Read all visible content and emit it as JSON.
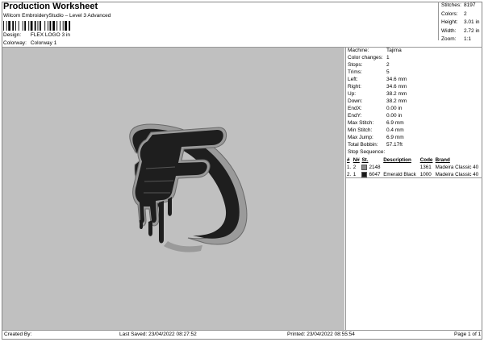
{
  "header": {
    "title": "Production Worksheet",
    "subtitle": "Wilcom EmbroideryStudio – Level 3 Advanced",
    "design_label": "Design:",
    "design_value": "FLEX LOGO 3 in",
    "colorway_label": "Colorway:",
    "colorway_value": "Colorway 1"
  },
  "top_stats": [
    {
      "label": "Stitches:",
      "value": "8197"
    },
    {
      "label": "Colors:",
      "value": "2"
    },
    {
      "label": "Height:",
      "value": "3.01 in"
    },
    {
      "label": "Width:",
      "value": "2.72 in"
    },
    {
      "label": "Zoom:",
      "value": "1:1"
    }
  ],
  "properties": [
    {
      "label": "Machine:",
      "value": "Tajima"
    },
    {
      "label": "Color changes:",
      "value": "1"
    },
    {
      "label": "Stops:",
      "value": "2"
    },
    {
      "label": "Trims:",
      "value": "5"
    },
    {
      "label": "Left:",
      "value": "34.6 mm"
    },
    {
      "label": "Right:",
      "value": "34.6 mm"
    },
    {
      "label": "Up:",
      "value": "38.2 mm"
    },
    {
      "label": "Down:",
      "value": "38.2 mm"
    },
    {
      "label": "EndX:",
      "value": "0.00 in"
    },
    {
      "label": "EndY:",
      "value": "0.00 in"
    },
    {
      "label": "Max Stitch:",
      "value": "6.9 mm"
    },
    {
      "label": "Min Stitch:",
      "value": "0.4 mm"
    },
    {
      "label": "Max Jump:",
      "value": "6.9 mm"
    },
    {
      "label": "Total Bobbin:",
      "value": "57.17ft"
    }
  ],
  "stop_sequence": {
    "heading": "Stop Sequence:",
    "columns": [
      "#",
      "N#",
      "St.",
      "Description",
      "Code",
      "Brand"
    ],
    "rows": [
      {
        "num": "1.",
        "n": "2",
        "swatch": "#8a8a8a",
        "st": "2148",
        "description": "",
        "code": "1361",
        "brand": "Madeira Classic 40"
      },
      {
        "num": "2.",
        "n": "1",
        "swatch": "#1a1a1a",
        "st": "6047",
        "description": "Emerald Black",
        "code": "1000",
        "brand": "Madeira Classic 40"
      }
    ]
  },
  "footer": {
    "created_by": "Created By:",
    "last_saved": "Last Saved: 23/04/2022 08:27:52",
    "printed": "Printed: 23/04/2022 08:55:54",
    "page": "Page 1 of 1"
  },
  "colors": {
    "design_background": "#c0c0c0",
    "logo_fill": "#1e1e1e",
    "logo_outline": "#9a9a9a"
  }
}
